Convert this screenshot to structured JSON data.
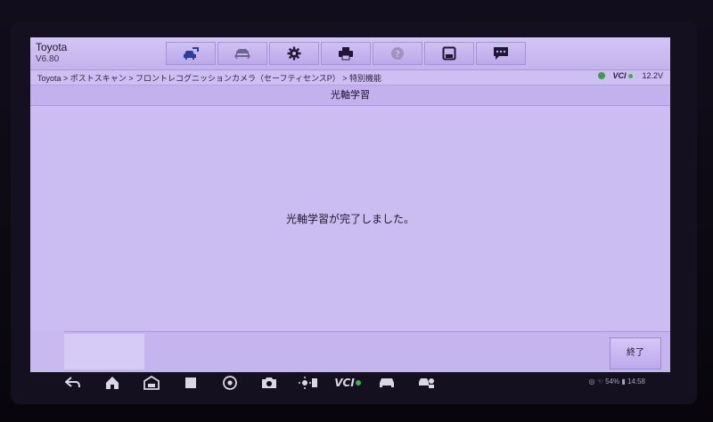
{
  "app": {
    "brand": "Toyota",
    "version": "V6.80"
  },
  "toolbar": {
    "buttons": [
      {
        "icon": "car-home-icon"
      },
      {
        "icon": "vehicle-swap-icon"
      },
      {
        "icon": "gear-icon"
      },
      {
        "icon": "printer-icon"
      },
      {
        "icon": "help-icon"
      },
      {
        "icon": "save-icon"
      },
      {
        "icon": "message-icon"
      }
    ]
  },
  "breadcrumb": "Toyota > ポストスキャン > フロントレコグニッションカメラ（セーフティセンスP） > 特別機能",
  "status": {
    "vci": "VCI",
    "voltage": "12.2V"
  },
  "page": {
    "title": "光軸学習"
  },
  "content": {
    "message": "光軸学習が完了しました。"
  },
  "footer": {
    "end_label": "終了"
  },
  "android": {
    "vci_label": "VCI",
    "status_text": "◎ ☜ 54% ▮ 14:58"
  },
  "colors": {
    "screen_bg": "#cbbdf1",
    "accent_icon": "#2b3f9a"
  }
}
